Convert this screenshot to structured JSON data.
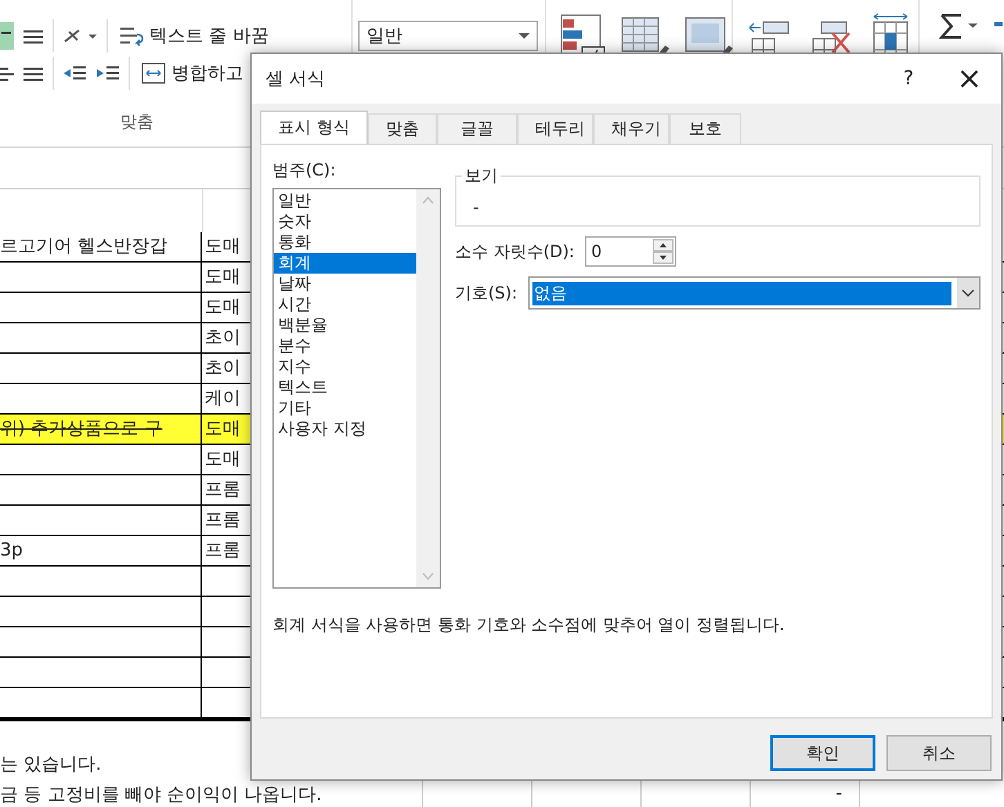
{
  "ribbon": {
    "wrap_text": "텍스트 줄 바꿈",
    "merge": "병합하고",
    "number_format": "일반",
    "group_label": "맞춤"
  },
  "sheet": {
    "rows": [
      {
        "col_1": "르고기어 헬스반장갑",
        "col_2": "도매",
        "highlighted": false,
        "strikethrough": false
      },
      {
        "col_2": "도매",
        "highlighted": false
      },
      {
        "col_2": "도매",
        "highlighted": false
      },
      {
        "col_2": "초이",
        "highlighted": false
      },
      {
        "col_2": "초이",
        "highlighted": false
      },
      {
        "col_2": "케이",
        "highlighted": false
      },
      {
        "col_1": "위)  추가상품으로 구",
        "col_2": "도매",
        "highlighted": true,
        "strikethrough": true
      },
      {
        "col_2": "도매",
        "highlighted": false
      },
      {
        "col_2": "프롬",
        "highlighted": false
      },
      {
        "col_2": "프롬",
        "highlighted": false
      },
      {
        "col_1": "3p",
        "col_2": "프롬",
        "highlighted": false,
        "strikethrough": false
      },
      {
        "highlighted": false
      },
      {
        "highlighted": false
      },
      {
        "highlighted": false
      },
      {
        "highlighted": false
      },
      {
        "highlighted": false
      }
    ],
    "notes": [
      "는 있습니다.",
      "금 등 고정비를 빼야 순이익이 나옵니다."
    ],
    "bottom_value": "-"
  },
  "dialog": {
    "title": "셀 서식",
    "help": "?",
    "close": "×",
    "tabs": [
      {
        "label": "표시 형식",
        "selected": true
      },
      {
        "label": "맞춤",
        "selected": false
      },
      {
        "label": "글꼴",
        "selected": false
      },
      {
        "label": "테두리",
        "selected": false
      },
      {
        "label": "채우기",
        "selected": false
      },
      {
        "label": "보호",
        "selected": false
      }
    ],
    "category_label": "범주(C):",
    "categories": [
      {
        "label": "일반",
        "selected": false
      },
      {
        "label": "숫자",
        "selected": false
      },
      {
        "label": "통화",
        "selected": false
      },
      {
        "label": "회계",
        "selected": true
      },
      {
        "label": "날짜",
        "selected": false
      },
      {
        "label": "시간",
        "selected": false
      },
      {
        "label": "백분율",
        "selected": false
      },
      {
        "label": "분수",
        "selected": false
      },
      {
        "label": "지수",
        "selected": false
      },
      {
        "label": "텍스트",
        "selected": false
      },
      {
        "label": "기타",
        "selected": false
      },
      {
        "label": "사용자 지정",
        "selected": false
      }
    ],
    "sample_label": "보기",
    "sample_value": "-",
    "decimal_label": "소수 자릿수(D):",
    "decimal_value": "0",
    "symbol_label": "기호(S):",
    "symbol_value": "없음",
    "description": "회계 서식을 사용하면 통화 기호와 소수점에 맞추어 열이 정렬됩니다.",
    "buttons": [
      {
        "label": "확인",
        "focused": true
      },
      {
        "label": "취소",
        "focused": false
      }
    ]
  }
}
